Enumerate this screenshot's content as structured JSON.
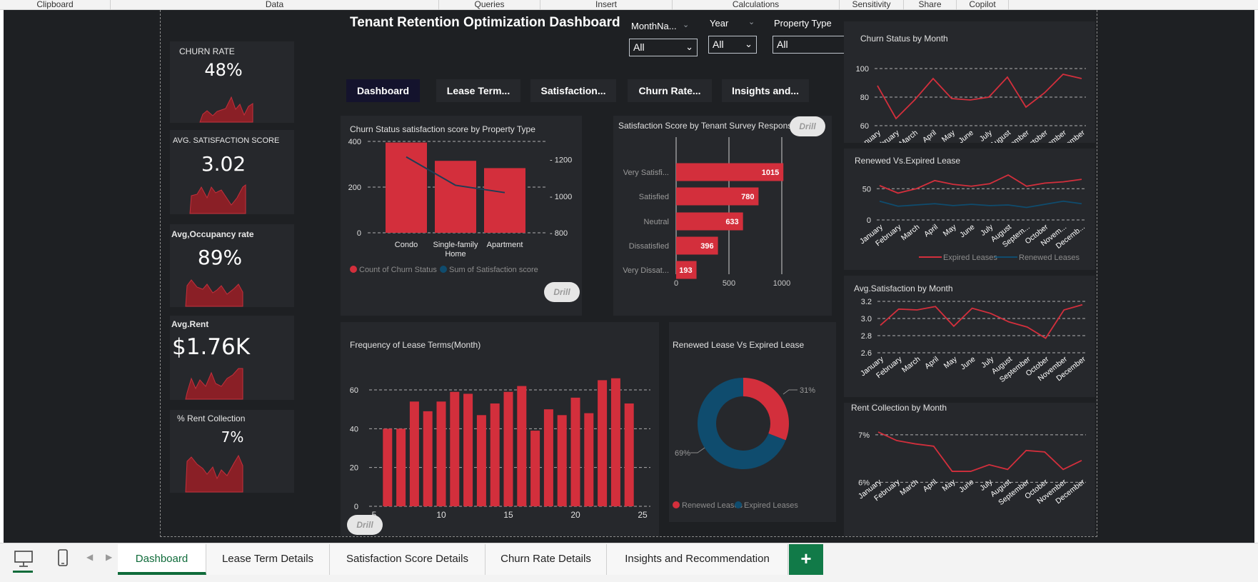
{
  "ribbon": [
    "Clipboard",
    "Data",
    "Queries",
    "Insert",
    "Calculations",
    "Sensitivity",
    "Share",
    "Copilot"
  ],
  "header": {
    "title": "Tenant Retention Optimization Dashboard"
  },
  "filters": [
    {
      "label": "MonthNa...",
      "value": "All"
    },
    {
      "label": "Year",
      "value": "All"
    },
    {
      "label": "Property Type",
      "value": "All"
    }
  ],
  "nav": [
    "Dashboard",
    "Lease Term...",
    "Satisfaction...",
    "Churn Rate...",
    "Insights and..."
  ],
  "drill_label": "Drill",
  "kpis": [
    {
      "title": "CHURN RATE",
      "value": "48%"
    },
    {
      "title": "AVG. SATISFACTION SCORE",
      "value": "3.02"
    },
    {
      "title": "Avg,Occupancy rate",
      "value": "89%"
    },
    {
      "title": "Avg.Rent",
      "value": "$1.76K"
    },
    {
      "title": "% Rent Collection",
      "value": "7%"
    }
  ],
  "colors": {
    "accent": "#d32f3c",
    "teal": "#0f4c6e",
    "bg": "#1e2023",
    "panel": "#26282c",
    "active_tab": "#0f6b3a"
  },
  "chart_data": [
    {
      "type": "bar",
      "title": "Churn Status satisfaction score by Property Type",
      "categories": [
        "Condo",
        "Single-family Home",
        "Apartment"
      ],
      "series": [
        {
          "name": "Count of Churn Status",
          "values": [
            395,
            315,
            283
          ]
        },
        {
          "name": "Sum of Satisfaction score",
          "values": [
            1215,
            1060,
            1020
          ]
        }
      ],
      "ylim": [
        0,
        400
      ],
      "y2lim": [
        800,
        1300
      ],
      "yticks": [
        "400",
        "200",
        "0"
      ],
      "y2ticks": [
        "1200",
        "1000",
        "800"
      ],
      "legend": "bottom"
    },
    {
      "type": "bar",
      "title": "Satisfaction Score by Tenant Survey Response",
      "categories": [
        "Very Satisfi...",
        "Satisfied",
        "Neutral",
        "Dissatisfied",
        "Very Dissat..."
      ],
      "values": [
        1015,
        780,
        633,
        396,
        193
      ],
      "xticks": [
        "0",
        "500",
        "1000"
      ]
    },
    {
      "type": "bar",
      "title": "Frequency of Lease Terms(Month)",
      "x": [
        6,
        7,
        8,
        9,
        10,
        11,
        12,
        13,
        14,
        15,
        16,
        17,
        18,
        19,
        20,
        21,
        22,
        23,
        24
      ],
      "values": [
        40,
        40,
        54,
        49,
        54,
        59,
        58,
        47,
        53,
        59,
        62,
        39,
        50,
        47,
        56,
        48,
        65,
        66,
        53
      ],
      "xticks": [
        "5",
        "10",
        "15",
        "20",
        "25"
      ],
      "yticks": [
        "60",
        "40",
        "20",
        "0"
      ],
      "ylim": [
        0,
        70
      ]
    },
    {
      "type": "pie",
      "title": "Renewed Lease Vs Expired Lease",
      "labels": [
        "Renewed Leases",
        "Expired Leases"
      ],
      "values": [
        31,
        69
      ],
      "value_labels": [
        "31%",
        "69%"
      ]
    },
    {
      "type": "line",
      "title": "Churn Status by Month",
      "categories": [
        "January",
        "February",
        "March",
        "April",
        "May",
        "June",
        "July",
        "August",
        "September",
        "October",
        "November",
        "December"
      ],
      "values": [
        88,
        65,
        78,
        93,
        79,
        78,
        80,
        94,
        73,
        83,
        96,
        93
      ],
      "ylim": [
        60,
        100
      ],
      "yticks": [
        "100",
        "80",
        "60"
      ]
    },
    {
      "type": "line",
      "title": "Renewed Vs.Expired Lease",
      "categories": [
        "January",
        "February",
        "March",
        "April",
        "May",
        "June",
        "July",
        "August",
        "Septem...",
        "October",
        "Novem...",
        "Decemb..."
      ],
      "series": [
        {
          "name": "Expired Leases",
          "values": [
            55,
            43,
            50,
            63,
            57,
            54,
            58,
            72,
            54,
            59,
            61,
            65
          ]
        },
        {
          "name": "Renewed Leases",
          "values": [
            30,
            22,
            24,
            26,
            23,
            25,
            23,
            24,
            20,
            25,
            30,
            26
          ]
        }
      ],
      "ylim": [
        0,
        80
      ],
      "yticks": [
        "50",
        "0"
      ],
      "legend": "bottom"
    },
    {
      "type": "line",
      "title": "Avg.Satisfaction by Month",
      "categories": [
        "January",
        "February",
        "March",
        "April",
        "May",
        "June",
        "July",
        "August",
        "September",
        "October",
        "November",
        "December"
      ],
      "values": [
        2.92,
        3.11,
        3.1,
        3.14,
        2.91,
        3.12,
        3.06,
        2.96,
        2.9,
        2.77,
        3.1,
        3.16
      ],
      "ylim": [
        2.6,
        3.2
      ],
      "yticks": [
        "3.2",
        "3.0",
        "2.8",
        "2.6"
      ]
    },
    {
      "type": "line",
      "title": "Rent Collection  by Month",
      "categories": [
        "January",
        "February",
        "March",
        "April",
        "May",
        "June",
        "July",
        "August",
        "September",
        "October",
        "November",
        "December"
      ],
      "values": [
        7.06,
        6.88,
        6.81,
        6.76,
        6.23,
        6.23,
        6.37,
        6.27,
        6.67,
        6.64,
        6.27,
        6.46
      ],
      "ylim": [
        5.9,
        7.3
      ],
      "yticks": [
        "7%",
        "6%"
      ]
    }
  ],
  "sheet_tabs": [
    "Dashboard",
    "Lease Term Details",
    "Satisfaction Score Details",
    "Churn Rate Details",
    "Insights and Recommendation"
  ]
}
